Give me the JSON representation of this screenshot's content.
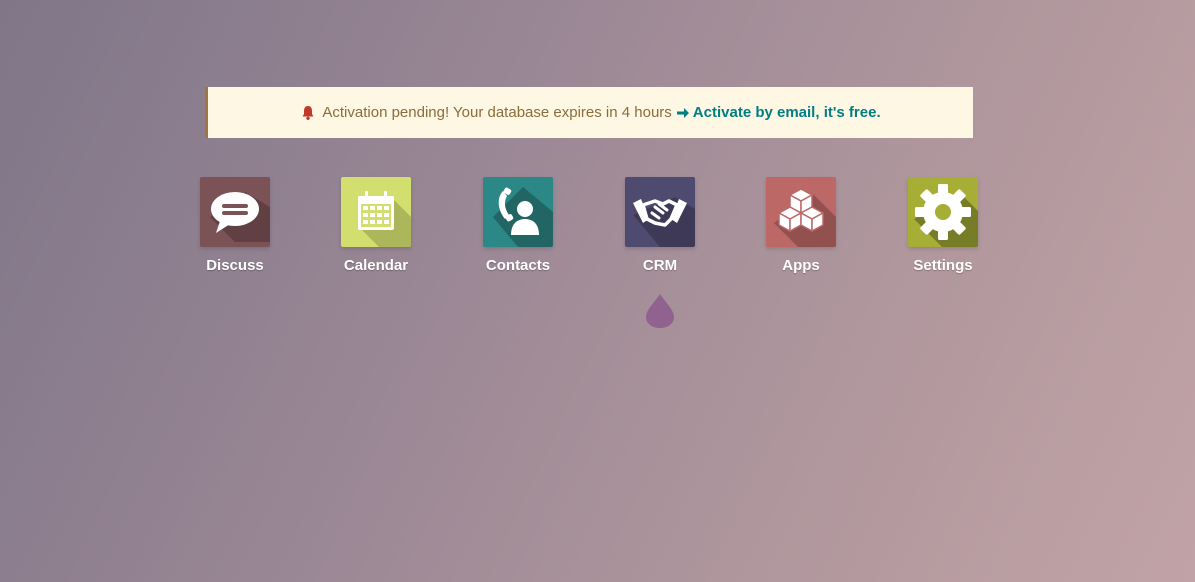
{
  "banner": {
    "message": "Activation pending! Your database expires in 4 hours",
    "link": "Activate by email, it's free.",
    "bell_icon": "bell-icon",
    "arrow_icon": "arrow-right-icon",
    "accent_color": "#8a6d3b",
    "link_color": "#017e84"
  },
  "apps": [
    {
      "label": "Discuss",
      "icon": "chat-bubble-icon",
      "color": "#7b5357"
    },
    {
      "label": "Calendar",
      "icon": "calendar-icon",
      "color": "#d2df6e"
    },
    {
      "label": "Contacts",
      "icon": "contact-phone-icon",
      "color": "#2c8787"
    },
    {
      "label": "CRM",
      "icon": "handshake-icon",
      "color": "#4f4a6f"
    },
    {
      "label": "Apps",
      "icon": "cubes-icon",
      "color": "#bb6866"
    },
    {
      "label": "Settings",
      "icon": "gear-icon",
      "color": "#a6ae36"
    }
  ]
}
